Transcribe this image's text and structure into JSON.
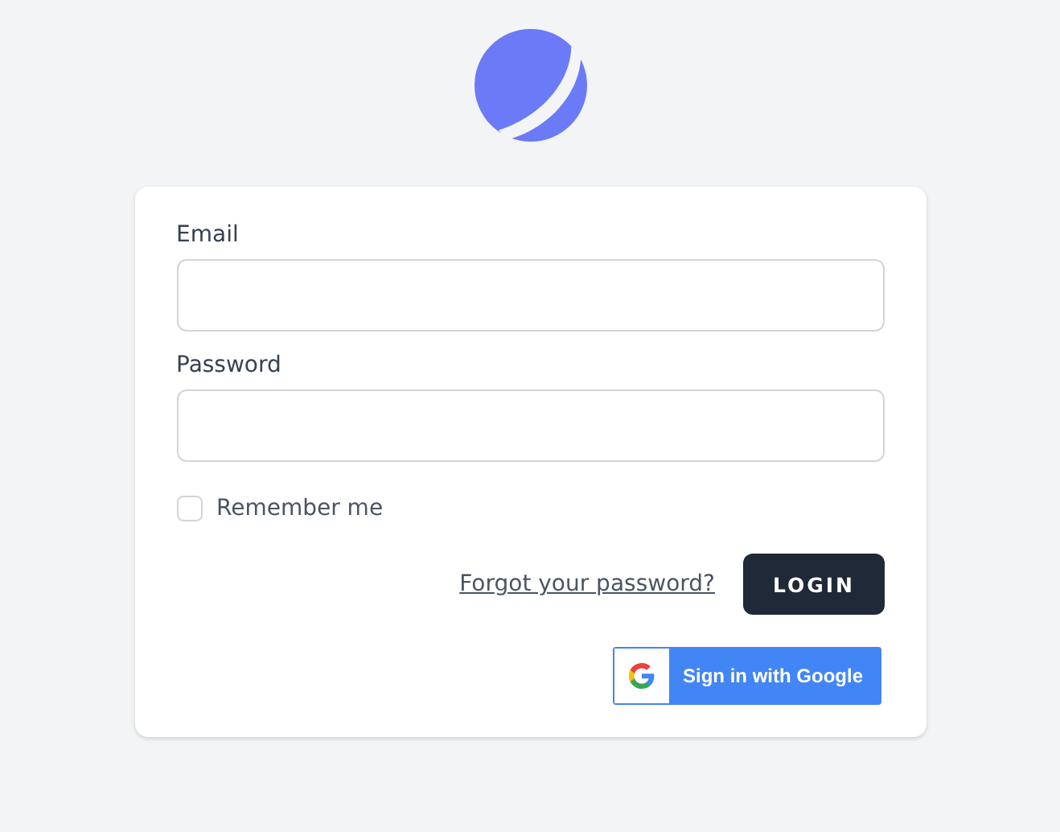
{
  "form": {
    "fields": [
      {
        "label": "Email"
      },
      {
        "label": "Password"
      }
    ],
    "remember": {
      "label": "Remember me",
      "checked": false
    },
    "forgot_link": "Forgot your password?",
    "login_button": "LOGIN",
    "google_button": "Sign in with Google"
  }
}
